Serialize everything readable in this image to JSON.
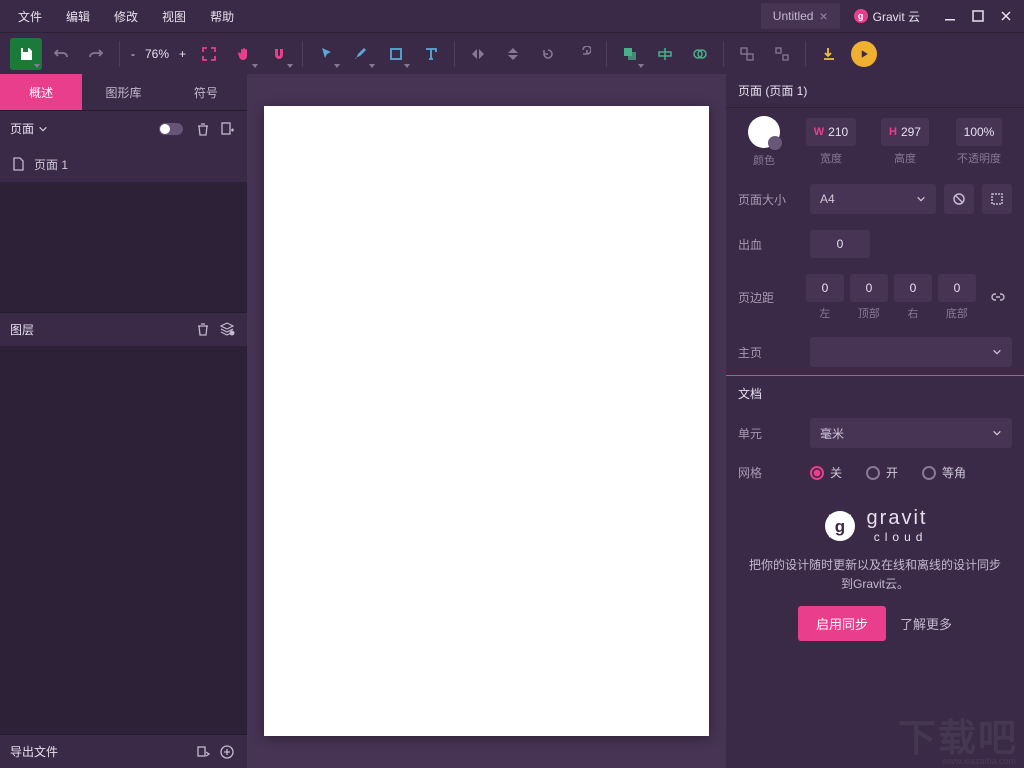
{
  "menu": {
    "items": [
      "文件",
      "编辑",
      "修改",
      "视图",
      "帮助"
    ]
  },
  "doctab": {
    "title": "Untitled"
  },
  "cloudmenu": {
    "label": "Gravit 云"
  },
  "toolbar": {
    "zoom": "76%"
  },
  "left": {
    "tabs": [
      "概述",
      "图形库",
      "符号"
    ],
    "pages_label": "页面",
    "page_item": "页面 1",
    "layers_label": "图层",
    "export_label": "导出文件"
  },
  "right": {
    "title": "页面 (页面 1)",
    "color_sub": "颜色",
    "w_pref": "W",
    "w_val": "210",
    "w_sub": "宽度",
    "h_pref": "H",
    "h_val": "297",
    "h_sub": "高度",
    "opacity_val": "100%",
    "opacity_sub": "不透明度",
    "size_label": "页面大小",
    "size_val": "A4",
    "bleed_label": "出血",
    "bleed_val": "0",
    "margin_label": "页边距",
    "margins": {
      "l": "0",
      "t": "0",
      "r": "0",
      "b": "0",
      "l_sub": "左",
      "t_sub": "顶部",
      "r_sub": "右",
      "b_sub": "底部"
    },
    "master_label": "主页",
    "doc_label": "文档",
    "unit_label": "单元",
    "unit_val": "毫米",
    "grid_label": "网格",
    "grid_opts": {
      "off": "关",
      "on": "开",
      "iso": "等角"
    },
    "cloud": {
      "brand_top": "gravit",
      "brand_sub": "cloud",
      "desc": "把你的设计随时更新以及在线和离线的设计同步到Gravit云。",
      "btn": "启用同步",
      "link": "了解更多"
    }
  },
  "watermark": {
    "big": "下载吧",
    "url": "www.xiazaiba.com"
  }
}
